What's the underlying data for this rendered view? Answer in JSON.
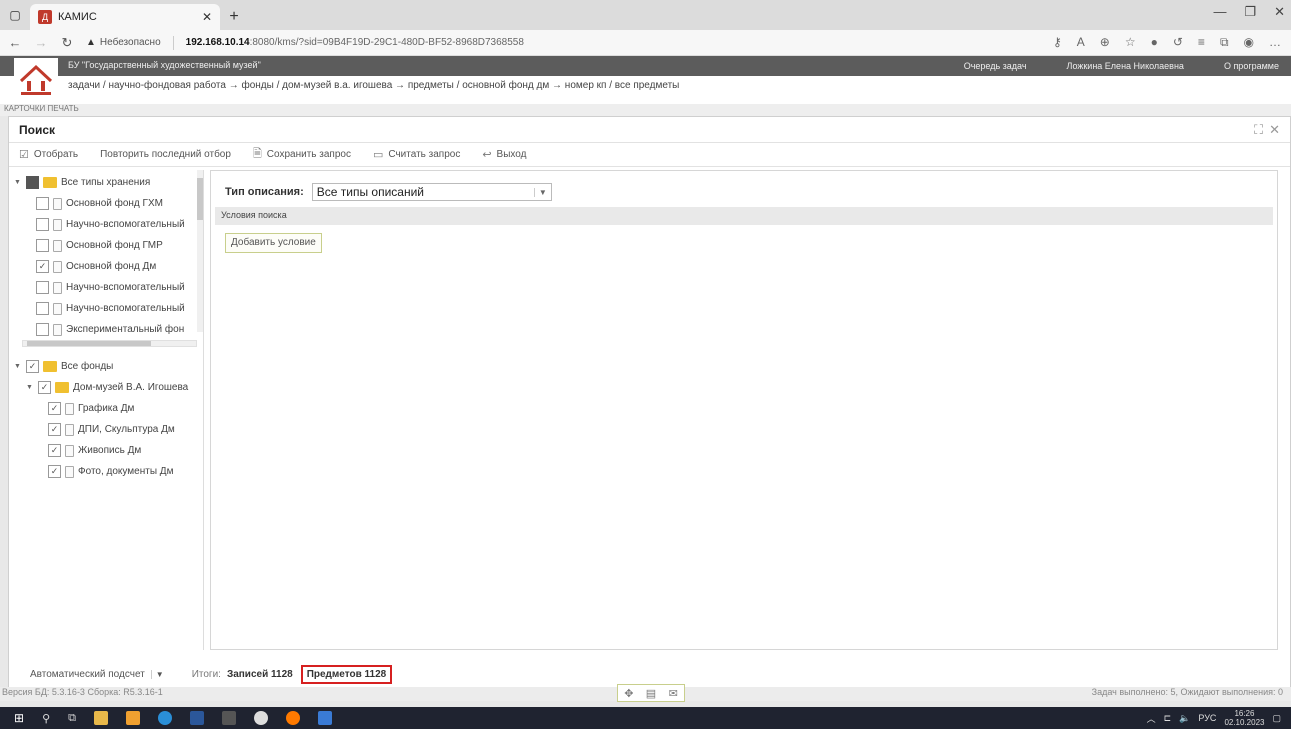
{
  "browser": {
    "tab_title": "КАМИС",
    "insecure_label": "Небезопасно",
    "url_host": "192.168.10.14",
    "url_rest": ":8080/kms/?sid=09B4F19D-29C1-480D-BF52-8968D7368558"
  },
  "app": {
    "org_name": "БУ \"Государственный художественный музей\"",
    "task_queue": "Очередь задач",
    "user": "Ложкина Елена Николаевна",
    "about": "О программе",
    "breadcrumb": "задачи / научно-фондовая работа → фонды / дом-музей в.а. игошева → предметы / основной фонд дм → номер кп / все предметы",
    "cards_row": "КАРТОЧКИ      ПЕЧАТЬ"
  },
  "dialog": {
    "title": "Поиск",
    "toolbar": {
      "select": "Отобрать",
      "repeat": "Повторить последний отбор",
      "save_query": "Сохранить запрос",
      "load_query": "Считать запрос",
      "exit": "Выход"
    }
  },
  "storage_tree": {
    "root": "Все типы хранения",
    "items": [
      {
        "label": "Основной фонд ГХМ",
        "checked": false
      },
      {
        "label": "Научно-вспомогательный",
        "checked": false
      },
      {
        "label": "Основной фонд ГМР",
        "checked": false
      },
      {
        "label": "Основной фонд Дм",
        "checked": true
      },
      {
        "label": "Научно-вспомогательный",
        "checked": false
      },
      {
        "label": "Научно-вспомогательный",
        "checked": false
      },
      {
        "label": "Экспериментальный фон",
        "checked": false
      }
    ]
  },
  "funds_tree": {
    "root": "Все фонды",
    "museum": "Дом-музей В.А. Игошева",
    "items": [
      "Графика Дм",
      "ДПИ, Скульптура Дм",
      "Живопись Дм",
      "Фото, документы Дм"
    ]
  },
  "search": {
    "desc_label": "Тип описания:",
    "desc_value": "Все типы описаний",
    "conditions_header": "Условия поиска",
    "add_condition": "Добавить условие"
  },
  "footer": {
    "auto_count": "Автоматический подсчет",
    "totals_label": "Итоги:",
    "records": "Записей 1128",
    "items": "Предметов 1128",
    "version": "Версия БД: 5.3.16-3 Сборка: R5.3.16-1",
    "tasks_status": "Задач выполнено: 5, Ожидают выполнения: 0"
  },
  "taskbar": {
    "lang": "РУС",
    "time": "16:26",
    "date": "02.10.2023"
  }
}
